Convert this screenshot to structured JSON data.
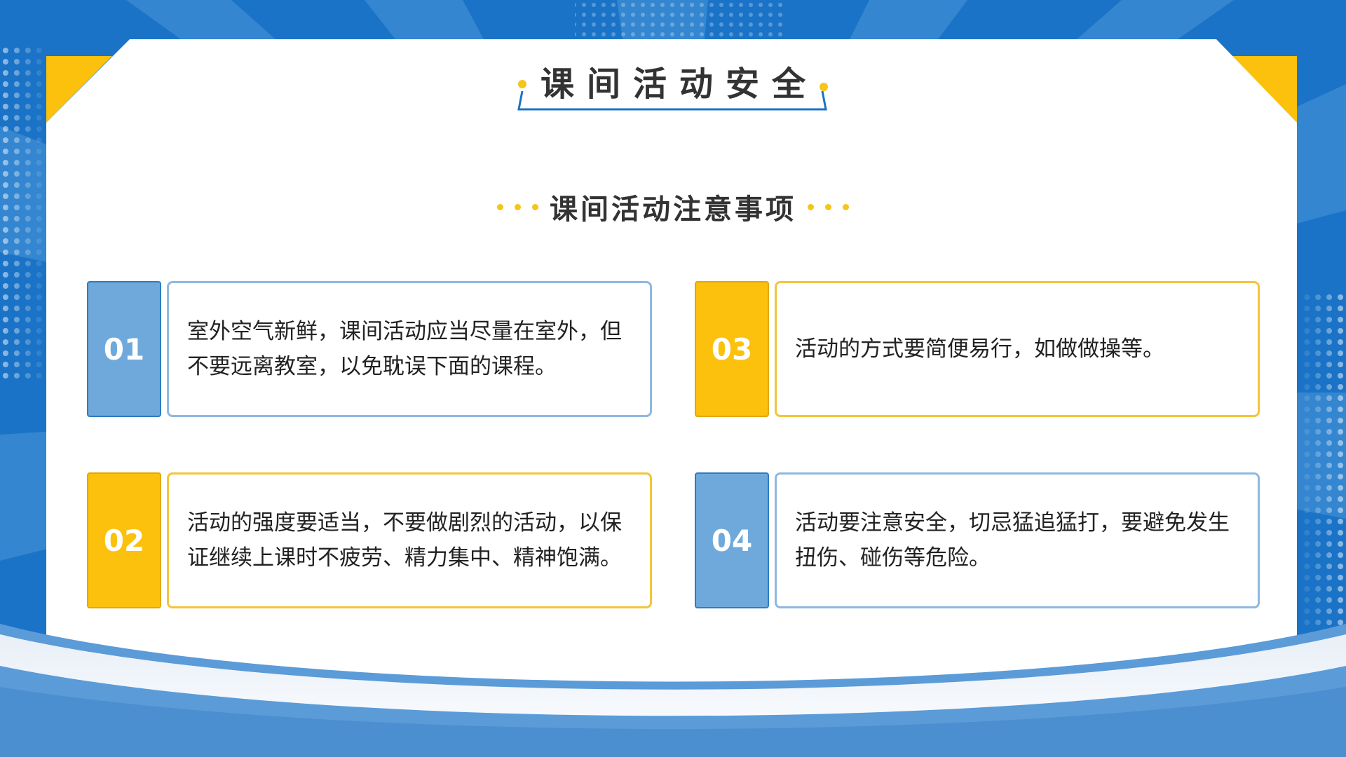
{
  "header": {
    "title": "课间活动安全",
    "subtitle": "课间活动注意事项"
  },
  "items": [
    {
      "number": "01",
      "text": "室外空气新鲜，课间活动应当尽量在室外，但不要远离教室，以免耽误下面的课程。",
      "accent": "blue"
    },
    {
      "number": "02",
      "text": "活动的强度要适当，不要做剧烈的活动，以保证继续上课时不疲劳、精力集中、精神饱满。",
      "accent": "yellow"
    },
    {
      "number": "03",
      "text": "活动的方式要简便易行，如做做操等。",
      "accent": "yellow"
    },
    {
      "number": "04",
      "text": "活动要注意安全，切忌猛追猛打，要避免发生扭伤、碰伤等危险。",
      "accent": "blue"
    }
  ],
  "colors": {
    "primary_blue": "#1a73c6",
    "light_blue": "#6fa9dc",
    "accent_yellow": "#fbc10d",
    "text_dark": "#333333"
  }
}
